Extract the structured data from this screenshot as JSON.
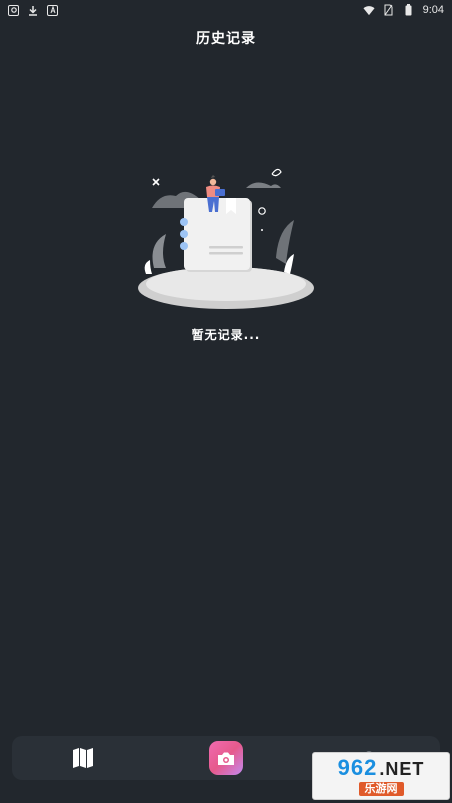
{
  "status_bar": {
    "time": "9:04",
    "left_icons": [
      "app-notification-icon",
      "download-icon",
      "font-icon"
    ],
    "right_icons": [
      "wifi-icon",
      "no-sim-icon",
      "battery-icon"
    ]
  },
  "header": {
    "title": "历史记录"
  },
  "empty_state": {
    "message": "暂无记录..."
  },
  "bottom_nav": {
    "items": [
      {
        "icon": "map-icon"
      },
      {
        "icon": "camera-icon"
      },
      {
        "icon": "profile-icon"
      }
    ],
    "accent": "#e65a8c"
  },
  "watermark": {
    "top_number": "962",
    "top_domain": ".NET",
    "bottom_text": "乐游网"
  },
  "colors": {
    "background": "#22272d",
    "bottom_bar": "#2a3037"
  }
}
